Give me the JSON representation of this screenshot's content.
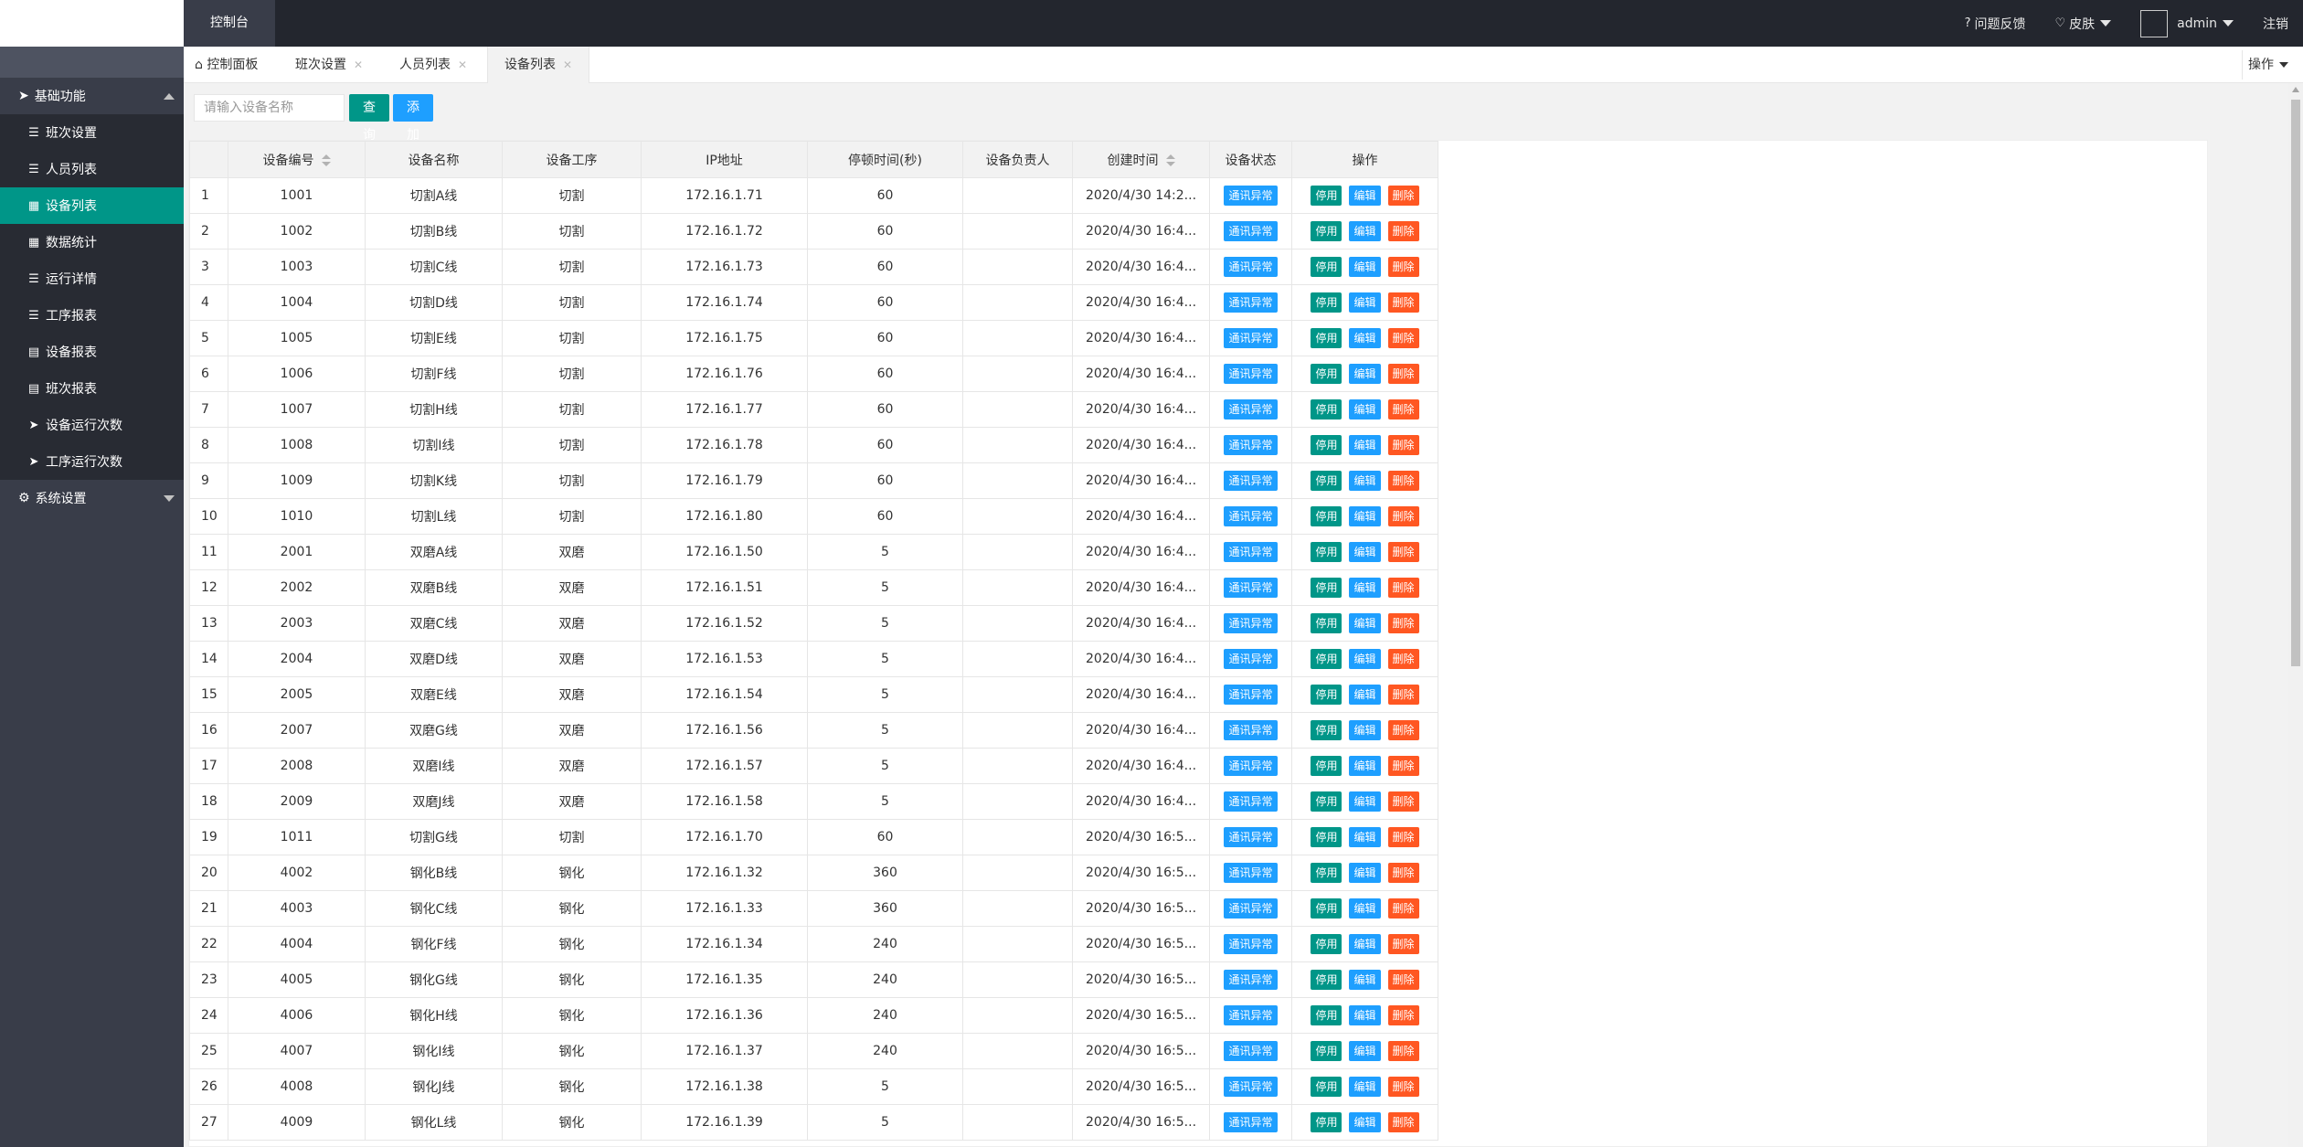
{
  "topbar": {
    "console_label": "控制台",
    "feedback_label": "问题反馈",
    "skin_label": "皮肤",
    "user_label": "admin",
    "logout_label": "注销"
  },
  "sidebar": {
    "groups": [
      {
        "label": "基础功能",
        "expanded": true,
        "items": [
          {
            "label": "班次设置",
            "icon": "list-icon"
          },
          {
            "label": "人员列表",
            "icon": "list-icon"
          },
          {
            "label": "设备列表",
            "icon": "table-icon",
            "active": true
          },
          {
            "label": "数据统计",
            "icon": "table-icon"
          },
          {
            "label": "运行详情",
            "icon": "list-icon"
          },
          {
            "label": "工序报表",
            "icon": "list-icon"
          },
          {
            "label": "设备报表",
            "icon": "grid-icon"
          },
          {
            "label": "班次报表",
            "icon": "grid-icon"
          },
          {
            "label": "设备运行次数",
            "icon": "send-icon"
          },
          {
            "label": "工序运行次数",
            "icon": "send-icon"
          }
        ]
      },
      {
        "label": "系统设置",
        "expanded": false
      }
    ]
  },
  "tabs": [
    {
      "label": "控制面板",
      "icon": "home-icon"
    },
    {
      "label": "班次设置"
    },
    {
      "label": "人员列表"
    },
    {
      "label": "设备列表",
      "active": true
    }
  ],
  "tab_ops_label": "操作",
  "search": {
    "placeholder": "请输入设备名称",
    "value": ""
  },
  "buttons": {
    "query": "查询",
    "add": "添加"
  },
  "table": {
    "headers": [
      "设备编号",
      "设备名称",
      "设备工序",
      "IP地址",
      "停顿时间(秒)",
      "设备负责人",
      "创建时间",
      "设备状态",
      "操作"
    ],
    "status_label": "通讯异常",
    "action_labels": {
      "stop": "停用",
      "edit": "编辑",
      "delete": "删除"
    },
    "rows": [
      [
        "1",
        "1001",
        "切割A线",
        "切割",
        "172.16.1.71",
        "60",
        "",
        "2020/4/30 14:2..."
      ],
      [
        "2",
        "1002",
        "切割B线",
        "切割",
        "172.16.1.72",
        "60",
        "",
        "2020/4/30 16:4..."
      ],
      [
        "3",
        "1003",
        "切割C线",
        "切割",
        "172.16.1.73",
        "60",
        "",
        "2020/4/30 16:4..."
      ],
      [
        "4",
        "1004",
        "切割D线",
        "切割",
        "172.16.1.74",
        "60",
        "",
        "2020/4/30 16:4..."
      ],
      [
        "5",
        "1005",
        "切割E线",
        "切割",
        "172.16.1.75",
        "60",
        "",
        "2020/4/30 16:4..."
      ],
      [
        "6",
        "1006",
        "切割F线",
        "切割",
        "172.16.1.76",
        "60",
        "",
        "2020/4/30 16:4..."
      ],
      [
        "7",
        "1007",
        "切割H线",
        "切割",
        "172.16.1.77",
        "60",
        "",
        "2020/4/30 16:4..."
      ],
      [
        "8",
        "1008",
        "切割I线",
        "切割",
        "172.16.1.78",
        "60",
        "",
        "2020/4/30 16:4..."
      ],
      [
        "9",
        "1009",
        "切割K线",
        "切割",
        "172.16.1.79",
        "60",
        "",
        "2020/4/30 16:4..."
      ],
      [
        "10",
        "1010",
        "切割L线",
        "切割",
        "172.16.1.80",
        "60",
        "",
        "2020/4/30 16:4..."
      ],
      [
        "11",
        "2001",
        "双磨A线",
        "双磨",
        "172.16.1.50",
        "5",
        "",
        "2020/4/30 16:4..."
      ],
      [
        "12",
        "2002",
        "双磨B线",
        "双磨",
        "172.16.1.51",
        "5",
        "",
        "2020/4/30 16:4..."
      ],
      [
        "13",
        "2003",
        "双磨C线",
        "双磨",
        "172.16.1.52",
        "5",
        "",
        "2020/4/30 16:4..."
      ],
      [
        "14",
        "2004",
        "双磨D线",
        "双磨",
        "172.16.1.53",
        "5",
        "",
        "2020/4/30 16:4..."
      ],
      [
        "15",
        "2005",
        "双磨E线",
        "双磨",
        "172.16.1.54",
        "5",
        "",
        "2020/4/30 16:4..."
      ],
      [
        "16",
        "2007",
        "双磨G线",
        "双磨",
        "172.16.1.56",
        "5",
        "",
        "2020/4/30 16:4..."
      ],
      [
        "17",
        "2008",
        "双磨I线",
        "双磨",
        "172.16.1.57",
        "5",
        "",
        "2020/4/30 16:4..."
      ],
      [
        "18",
        "2009",
        "双磨J线",
        "双磨",
        "172.16.1.58",
        "5",
        "",
        "2020/4/30 16:4..."
      ],
      [
        "19",
        "1011",
        "切割G线",
        "切割",
        "172.16.1.70",
        "60",
        "",
        "2020/4/30 16:5..."
      ],
      [
        "20",
        "4002",
        "钢化B线",
        "钢化",
        "172.16.1.32",
        "360",
        "",
        "2020/4/30 16:5..."
      ],
      [
        "21",
        "4003",
        "钢化C线",
        "钢化",
        "172.16.1.33",
        "360",
        "",
        "2020/4/30 16:5..."
      ],
      [
        "22",
        "4004",
        "钢化F线",
        "钢化",
        "172.16.1.34",
        "240",
        "",
        "2020/4/30 16:5..."
      ],
      [
        "23",
        "4005",
        "钢化G线",
        "钢化",
        "172.16.1.35",
        "240",
        "",
        "2020/4/30 16:5..."
      ],
      [
        "24",
        "4006",
        "钢化H线",
        "钢化",
        "172.16.1.36",
        "240",
        "",
        "2020/4/30 16:5..."
      ],
      [
        "25",
        "4007",
        "钢化I线",
        "钢化",
        "172.16.1.37",
        "240",
        "",
        "2020/4/30 16:5..."
      ],
      [
        "26",
        "4008",
        "钢化J线",
        "钢化",
        "172.16.1.38",
        "5",
        "",
        "2020/4/30 16:5..."
      ],
      [
        "27",
        "4009",
        "钢化L线",
        "钢化",
        "172.16.1.39",
        "5",
        "",
        "2020/4/30 16:5..."
      ]
    ]
  },
  "colors": {
    "topbar": "#23262e",
    "sidebar": "#393d49",
    "active": "#009688",
    "blue": "#1e9fff",
    "danger": "#ff5722"
  }
}
